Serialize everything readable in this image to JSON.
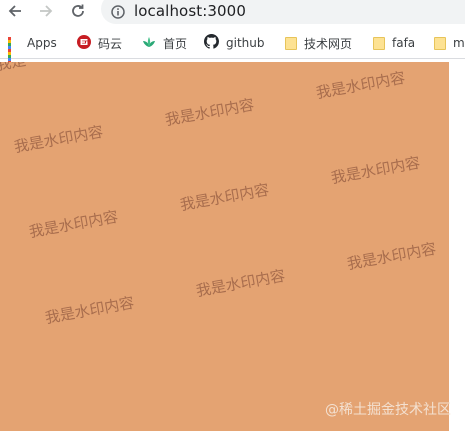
{
  "browser": {
    "url": "localhost:3000",
    "bookmarks": [
      {
        "label": "Apps",
        "icon": "apps-grid-icon"
      },
      {
        "label": "码云",
        "icon": "gitee-icon"
      },
      {
        "label": "首页",
        "icon": "leaf-icon"
      },
      {
        "label": "github",
        "icon": "github-icon"
      },
      {
        "label": "技术网页",
        "icon": "folder-icon"
      },
      {
        "label": "fafa",
        "icon": "folder-icon"
      },
      {
        "label": "m",
        "icon": "folder-icon"
      }
    ]
  },
  "page": {
    "background": "#e4a372",
    "watermark_text": "我是水印内容",
    "watermark_top_fragment": "我是",
    "corner_mark": "@稀土掘金技术社区"
  }
}
